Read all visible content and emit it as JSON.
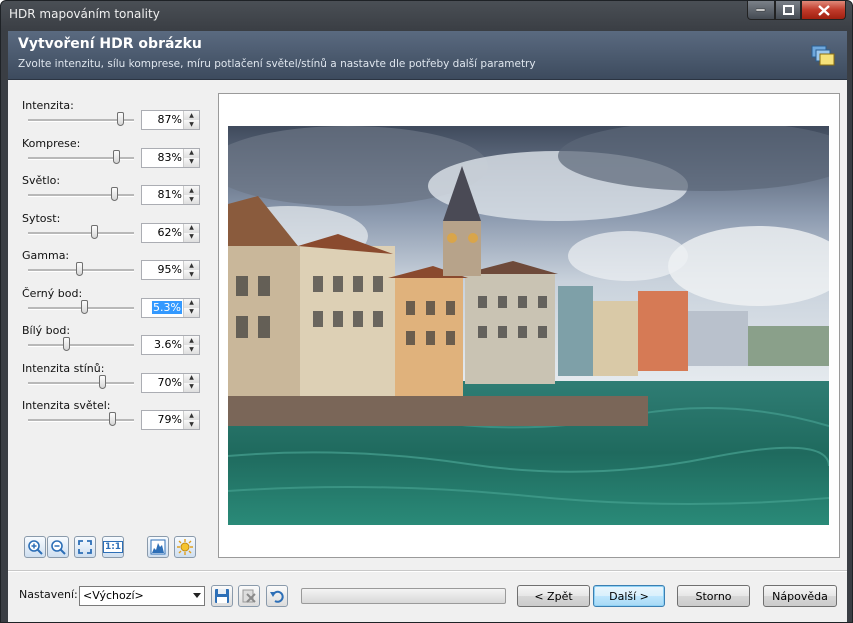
{
  "window": {
    "title": "HDR mapováním tonality"
  },
  "header": {
    "title": "Vytvoření HDR obrázku",
    "subtitle": "Zvolte intenzitu, sílu komprese, míru potlačení světel/stínů a nastavte dle potřeby další parametry",
    "icon": "windows-stack-icon"
  },
  "params": [
    {
      "label": "Intenzita:",
      "value": "87%",
      "level": 0.87
    },
    {
      "label": "Komprese:",
      "value": "83%",
      "level": 0.83
    },
    {
      "label": "Světlo:",
      "value": "81%",
      "level": 0.81
    },
    {
      "label": "Sytost:",
      "value": "62%",
      "level": 0.62
    },
    {
      "label": "Gamma:",
      "value": "95%",
      "level": 0.48
    },
    {
      "label": "Černý bod:",
      "value": "5.3%",
      "level": 0.53,
      "selected": true
    },
    {
      "label": "Bílý bod:",
      "value": "3.6%",
      "level": 0.36
    },
    {
      "label": "Intenzita stínů:",
      "value": "70%",
      "level": 0.7
    },
    {
      "label": "Intenzita světel:",
      "value": "79%",
      "level": 0.79
    }
  ],
  "view_tools": [
    {
      "name": "zoom-in-icon"
    },
    {
      "name": "zoom-out-icon"
    },
    {
      "name": "fit-to-window-icon"
    },
    {
      "name": "actual-size-icon",
      "text": "1:1"
    },
    {
      "name": "histogram-icon"
    },
    {
      "name": "sun-icon"
    }
  ],
  "preview": {
    "description": "HDR tone-mapped photo"
  },
  "bottom": {
    "settings_label": "Nastavení:",
    "preset_value": "<Výchozí>",
    "save_icon": "save-icon",
    "delete_icon": "delete-preset-icon",
    "reset_icon": "undo-icon",
    "progress": 0,
    "back_label": "< Zpět",
    "next_label": "Další >",
    "cancel_label": "Storno",
    "help_label": "Nápověda"
  },
  "colors": {
    "accent": "#3399ff",
    "header_bg": "#4a596c"
  }
}
